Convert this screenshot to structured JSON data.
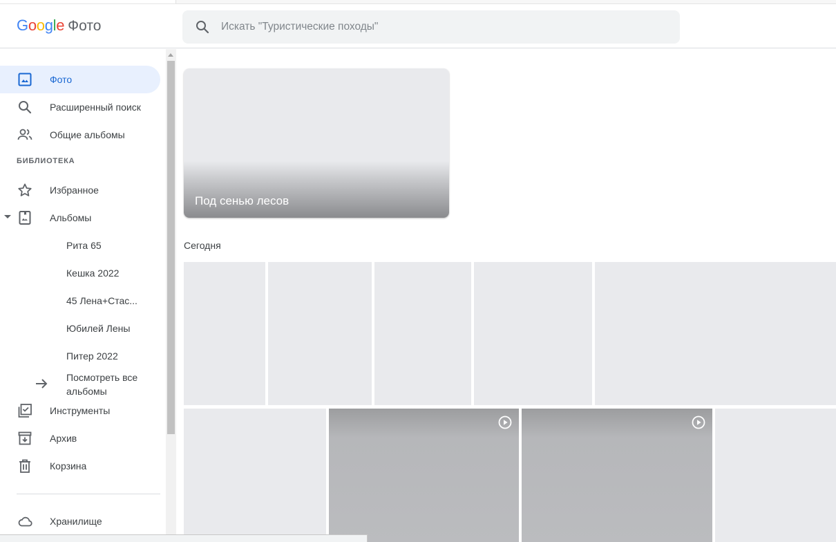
{
  "header": {
    "logo_letters": [
      {
        "ch": "G",
        "color": "#4285f4"
      },
      {
        "ch": "o",
        "color": "#ea4335"
      },
      {
        "ch": "o",
        "color": "#fbbc05"
      },
      {
        "ch": "g",
        "color": "#4285f4"
      },
      {
        "ch": "l",
        "color": "#34a853"
      },
      {
        "ch": "e",
        "color": "#ea4335"
      }
    ],
    "product_name": "Фото",
    "search_placeholder": "Искать \"Туристические походы\"",
    "search_icon": "search-icon"
  },
  "sidebar": {
    "items": [
      {
        "label": "Фото",
        "icon": "photo-icon",
        "active": true
      },
      {
        "label": "Расширенный поиск",
        "icon": "search-icon"
      },
      {
        "label": "Общие альбомы",
        "icon": "shared-people-icon"
      }
    ],
    "library_label": "БИБЛИОТЕКА",
    "library_items": [
      {
        "label": "Избранное",
        "icon": "star-icon"
      },
      {
        "label": "Альбомы",
        "icon": "album-icon",
        "expanded": true
      }
    ],
    "albums": [
      {
        "label": "Рита 65"
      },
      {
        "label": "Кешка 2022"
      },
      {
        "label": "45 Лена+Стас..."
      },
      {
        "label": "Юбилей Лены"
      },
      {
        "label": "Питер 2022"
      }
    ],
    "see_all_label": "Посмотреть все альбомы",
    "tools": [
      {
        "label": "Инструменты",
        "icon": "utilities-checkbox-icon"
      },
      {
        "label": "Архив",
        "icon": "archive-icon"
      },
      {
        "label": "Корзина",
        "icon": "trash-icon"
      }
    ],
    "storage_label": "Хранилище",
    "accent_color": "#1967d2",
    "active_bg": "#e8f0fe"
  },
  "main": {
    "memory": {
      "title": "Под сенью лесов"
    },
    "day_label": "Сегодня",
    "video_icon": "play-circle-icon"
  }
}
